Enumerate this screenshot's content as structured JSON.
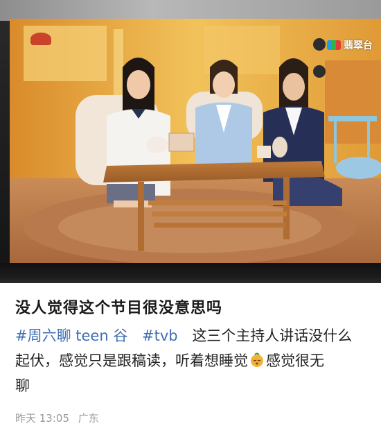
{
  "tv": {
    "channel_name": "翡翠台"
  },
  "post": {
    "title": "没人觉得这个节目很没意思吗",
    "tags": [
      "#周六聊 teen 谷",
      "#tvb"
    ],
    "text_line1_after_tags": "这三个主持人讲话没什么",
    "text_line2": "起伏，感觉只是跟稿读，听着想睡觉",
    "text_line2_after_emoji": "感觉很无",
    "text_line3": "聊",
    "emoji_name": "sleepy-orange-face-icon",
    "date": "昨天 13:05",
    "location": "广东"
  },
  "colors": {
    "tag": "#3e6fb3",
    "meta": "#9a9a9a",
    "studio_orange": "#e6a63a"
  }
}
